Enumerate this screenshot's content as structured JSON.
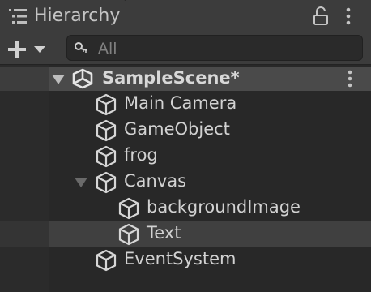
{
  "window": {
    "tab_title": "Hierarchy",
    "tab_icon": "hierarchy-list-icon",
    "lock_icon": "lock-icon",
    "menu_icon": "kebab-menu-icon"
  },
  "toolbar": {
    "add_icon": "plus-icon",
    "dropdown_icon": "triangle-down-icon",
    "search": {
      "icon": "search-icon",
      "placeholder": "All",
      "value": ""
    }
  },
  "scene": {
    "name": "SampleScene*",
    "icon": "unity-logo-icon",
    "expanded": true,
    "menu_icon": "kebab-menu-icon"
  },
  "items": [
    {
      "label": "Main Camera",
      "depth": 1,
      "icon": "gameobject-cube-icon",
      "has_children": false,
      "selected": false
    },
    {
      "label": "GameObject",
      "depth": 1,
      "icon": "gameobject-cube-icon",
      "has_children": false,
      "selected": false
    },
    {
      "label": "frog",
      "depth": 1,
      "icon": "gameobject-cube-icon",
      "has_children": false,
      "selected": false
    },
    {
      "label": "Canvas",
      "depth": 1,
      "icon": "gameobject-cube-icon",
      "has_children": true,
      "expanded": true,
      "selected": false
    },
    {
      "label": "backgroundImage",
      "depth": 2,
      "icon": "gameobject-cube-icon",
      "has_children": false,
      "selected": false
    },
    {
      "label": "Text",
      "depth": 2,
      "icon": "gameobject-cube-icon",
      "has_children": false,
      "selected": true
    },
    {
      "label": "EventSystem",
      "depth": 1,
      "icon": "gameobject-cube-icon",
      "has_children": false,
      "selected": false
    }
  ],
  "colors": {
    "panel": "#282828",
    "header": "#3c3c3c",
    "scene_row": "#4a4a4a",
    "selected_row": "#404040",
    "text": "#d2d2d2"
  }
}
